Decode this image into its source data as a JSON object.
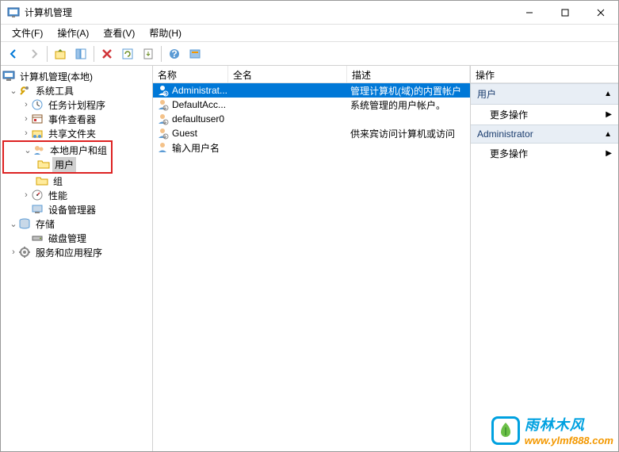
{
  "window": {
    "title": "计算机管理"
  },
  "menu": {
    "file": "文件(F)",
    "action": "操作(A)",
    "view": "查看(V)",
    "help": "帮助(H)"
  },
  "tree": {
    "root": "计算机管理(本地)",
    "systools": "系统工具",
    "tasksched": "任务计划程序",
    "eventvwr": "事件查看器",
    "shared": "共享文件夹",
    "localusr": "本地用户和组",
    "users": "用户",
    "groups": "组",
    "perf": "性能",
    "devmgr": "设备管理器",
    "storage": "存储",
    "diskmgmt": "磁盘管理",
    "svcapps": "服务和应用程序"
  },
  "list": {
    "col_name": "名称",
    "col_full": "全名",
    "col_desc": "描述",
    "rows": [
      {
        "name": "Administrat...",
        "full": "",
        "desc": "管理计算机(域)的内置帐户"
      },
      {
        "name": "DefaultAcc...",
        "full": "",
        "desc": "系统管理的用户帐户。"
      },
      {
        "name": "defaultuser0",
        "full": "",
        "desc": ""
      },
      {
        "name": "Guest",
        "full": "",
        "desc": "供来宾访问计算机或访问"
      },
      {
        "name": "输入用户名",
        "full": "",
        "desc": ""
      }
    ]
  },
  "actions": {
    "header": "操作",
    "g1": "用户",
    "g1_more": "更多操作",
    "g2": "Administrator",
    "g2_more": "更多操作"
  },
  "watermark": {
    "cn": "雨林木风",
    "url": "www.ylmf888.com"
  }
}
